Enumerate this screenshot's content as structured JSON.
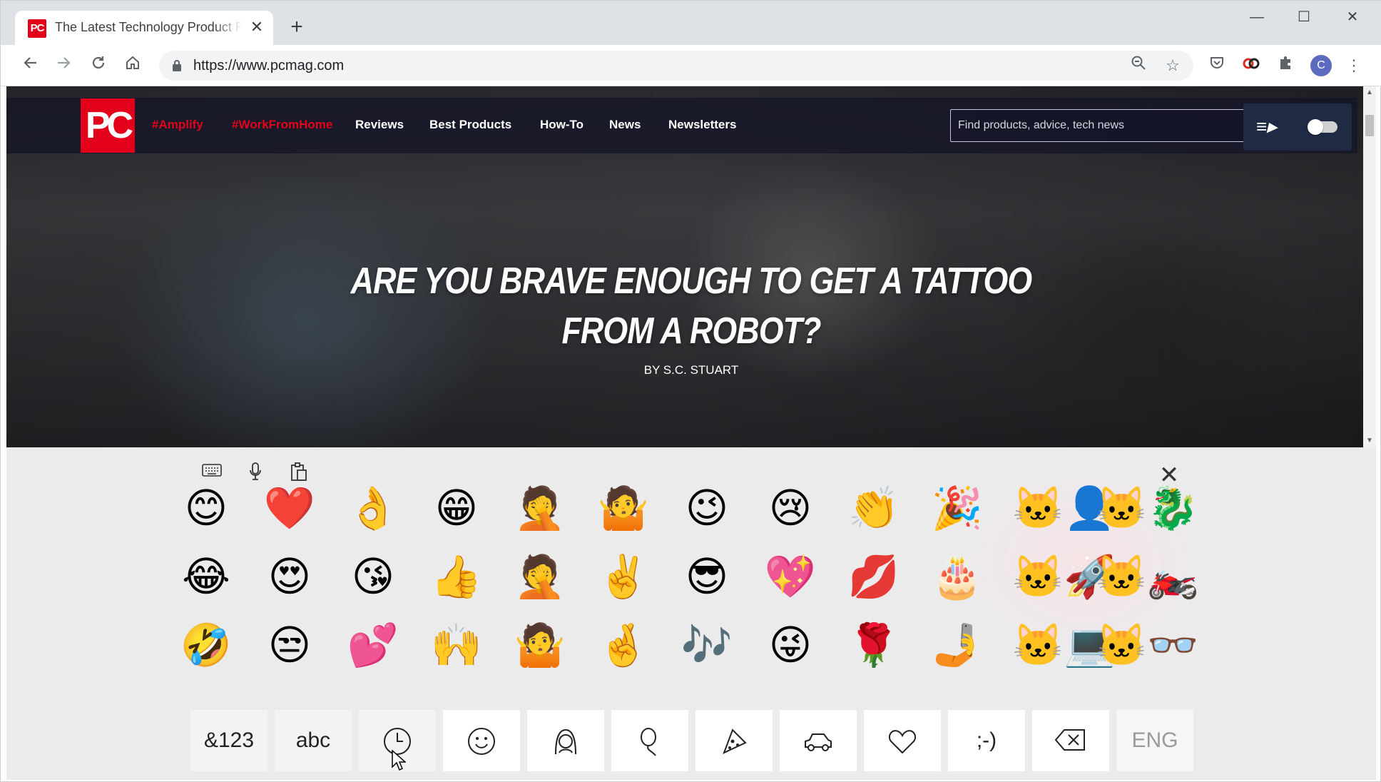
{
  "browser": {
    "tab_title": "The Latest Technology Product Reviews, News, Tips, and Deals | PCMag",
    "tab_favicon": "PC",
    "url": "https://www.pcmag.com",
    "profile_initial": "C",
    "icons": [
      "back-icon",
      "forward-icon",
      "reload-icon",
      "home-icon",
      "lock-icon",
      "zoom-icon",
      "star-icon",
      "pocket-icon",
      "extension-icon",
      "puzzle-icon"
    ]
  },
  "site": {
    "logo": "PC",
    "nav": [
      {
        "label": "#Amplify"
      },
      {
        "label": "#WorkFromHome"
      },
      {
        "label": "Reviews"
      },
      {
        "label": "Best Products"
      },
      {
        "label": "How-To"
      },
      {
        "label": "News"
      },
      {
        "label": "Newsletters"
      }
    ],
    "search_placeholder": "Find products, advice, tech news"
  },
  "hero": {
    "headline_line1": "Are You Brave Enough to Get a Tattoo",
    "headline_line2": "From a Robot?",
    "byline": "BY S.C. STUART"
  },
  "keyboard": {
    "emoji_rows": [
      [
        "😊",
        "❤️",
        "👌",
        "😁",
        "🤦",
        "🤷",
        "😉",
        "😢",
        "👏",
        "🎉",
        "🐱‍👤",
        "🐱‍🐉"
      ],
      [
        "😂",
        "😍",
        "😘",
        "👍",
        "🤦",
        "✌️",
        "😎",
        "💖",
        "💋",
        "🎂",
        "🐱‍🚀",
        "🐱‍🏍"
      ],
      [
        "🤣",
        "😒",
        "💕",
        "🙌",
        "🤷",
        "🤞",
        "🎶",
        "😜",
        "🌹",
        "🤳",
        "🐱‍💻",
        "🐱‍👓"
      ]
    ],
    "keys": {
      "symbols": "&123",
      "letters": "abc",
      "language": "ENG"
    }
  }
}
